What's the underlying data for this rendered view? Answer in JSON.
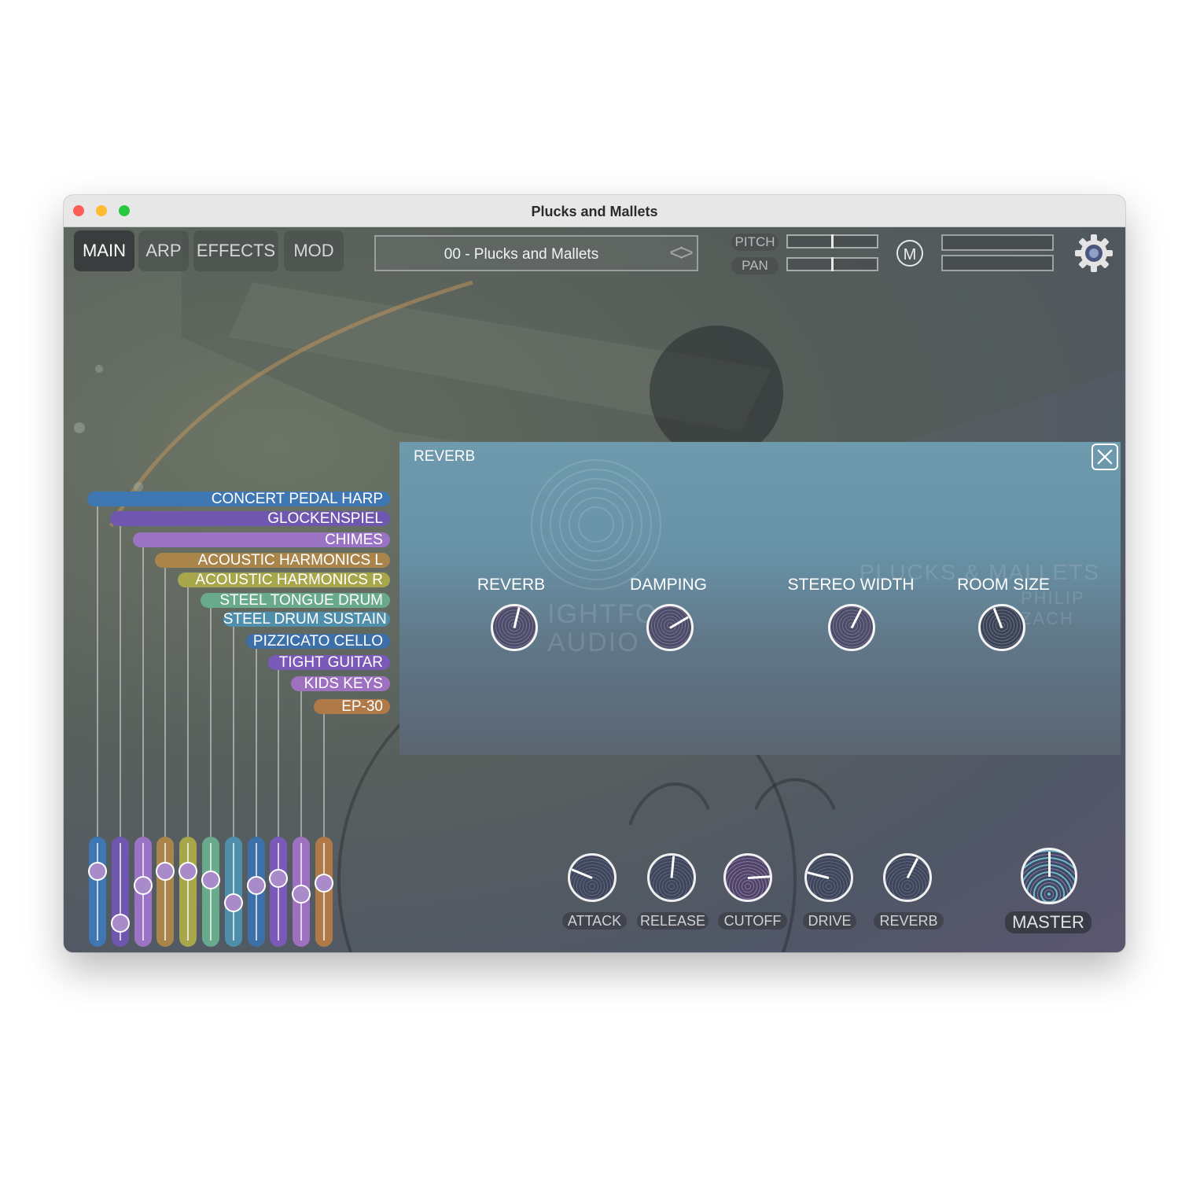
{
  "window": {
    "title": "Plucks and Mallets"
  },
  "tabs": [
    "MAIN",
    "ARP",
    "EFFECTS",
    "MOD"
  ],
  "preset": {
    "name": "00 - Plucks and Mallets",
    "arrows": "<>"
  },
  "pitch_label": "PITCH",
  "pan_label": "PAN",
  "m_button": "M",
  "reverb_panel": {
    "title": "REVERB",
    "watermark_left": "IGHTFO",
    "watermark_left2": "AUDIO",
    "watermark_right": "PLUCKS & MALLETS",
    "watermark_right2": "PHILIP ZACH",
    "knobs": [
      {
        "label": "REVERB",
        "value": 0.55
      },
      {
        "label": "DAMPING",
        "value": 0.72
      },
      {
        "label": "STEREO WIDTH",
        "value": 0.6
      },
      {
        "label": "ROOM SIZE",
        "value": 0.42
      }
    ]
  },
  "channels": [
    {
      "name": "CONCERT PEDAL HARP",
      "color": "#3f77b3",
      "level": 0.78
    },
    {
      "name": "GLOCKENSPIEL",
      "color": "#6f57b0",
      "level": 0.18
    },
    {
      "name": "CHIMES",
      "color": "#9b73c4",
      "level": 0.62
    },
    {
      "name": "ACOUSTIC HARMONICS L",
      "color": "#a9854c",
      "level": 0.78
    },
    {
      "name": "ACOUSTIC HARMONICS R",
      "color": "#a8a64a",
      "level": 0.78
    },
    {
      "name": "STEEL TONGUE DRUM",
      "color": "#69a98c",
      "level": 0.68
    },
    {
      "name": "STEEL DRUM SUSTAIN",
      "color": "#4f8fac",
      "level": 0.42
    },
    {
      "name": "PIZZICATO CELLO",
      "color": "#3d70a9",
      "level": 0.62
    },
    {
      "name": "TIGHT GUITAR",
      "color": "#7a59b8",
      "level": 0.7
    },
    {
      "name": "KIDS KEYS",
      "color": "#9e70c0",
      "level": 0.52
    },
    {
      "name": "EP-30",
      "color": "#b07a48",
      "level": 0.65
    }
  ],
  "bottom_knobs": [
    {
      "label": "ATTACK",
      "value": 0.25
    },
    {
      "label": "RELEASE",
      "value": 0.52
    },
    {
      "label": "CUTOFF",
      "value": 0.82
    },
    {
      "label": "DRIVE",
      "value": 0.22
    },
    {
      "label": "REVERB",
      "value": 0.6
    }
  ],
  "master": {
    "label": "MASTER",
    "value": 0.5
  }
}
